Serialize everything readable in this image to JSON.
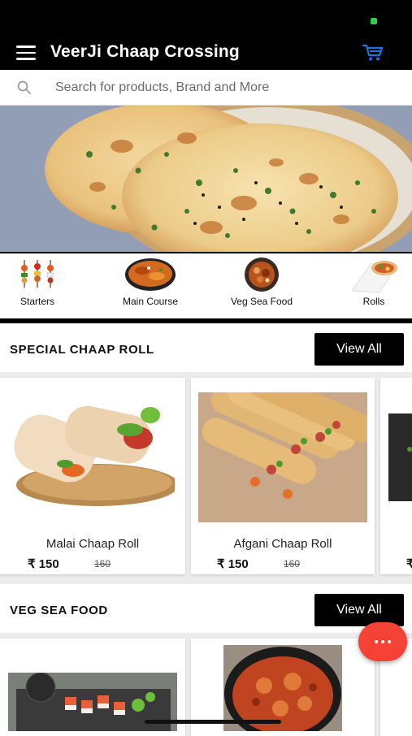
{
  "header": {
    "title": "VeerJi Chaap Crossing",
    "menu_icon": "hamburger-menu-icon",
    "cart_icon": "shopping-cart-icon",
    "accent": "#1a73e8"
  },
  "search": {
    "placeholder": "Search for products, Brand and More"
  },
  "categories": [
    {
      "label": "Starters",
      "icon": "skewers-icon"
    },
    {
      "label": "Main Course",
      "icon": "curry-bowl-icon"
    },
    {
      "label": "Veg Sea Food",
      "icon": "seafood-plate-icon"
    },
    {
      "label": "Rolls",
      "icon": "wrap-roll-icon"
    }
  ],
  "sections": [
    {
      "title": "SPECIAL CHAAP ROLL",
      "view_all": "View All",
      "items": [
        {
          "name": "Malai Chaap Roll",
          "price": "₹ 150",
          "old_price": "160"
        },
        {
          "name": "Afgani Chaap Roll",
          "price": "₹ 150",
          "old_price": "160"
        },
        {
          "price": "₹"
        }
      ]
    },
    {
      "title": "VEG SEA FOOD",
      "view_all": "View All"
    }
  ],
  "colors": {
    "fab": "#f44336",
    "topbar": "#000000",
    "view_all_bg": "#000000"
  },
  "fab_icon": "more-dots-icon"
}
